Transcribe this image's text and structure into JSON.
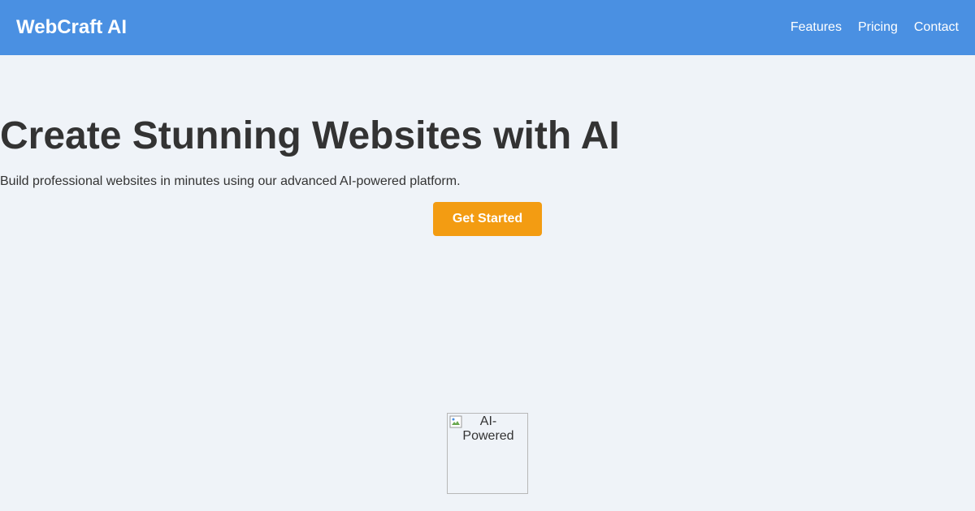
{
  "navbar": {
    "brand": "WebCraft AI",
    "links": [
      "Features",
      "Pricing",
      "Contact"
    ],
    "background_color": "#4a90e2"
  },
  "hero": {
    "title": "Create Stunning Websites with AI",
    "subtitle": "Build professional websites in minutes using our advanced AI-powered platform.",
    "cta_label": "Get Started",
    "cta_color": "#f39c12"
  },
  "feature_image": {
    "alt": "AI-Powered",
    "icon": "broken-image-icon"
  },
  "colors": {
    "page_background": "#eff3f8",
    "text": "#333333"
  }
}
